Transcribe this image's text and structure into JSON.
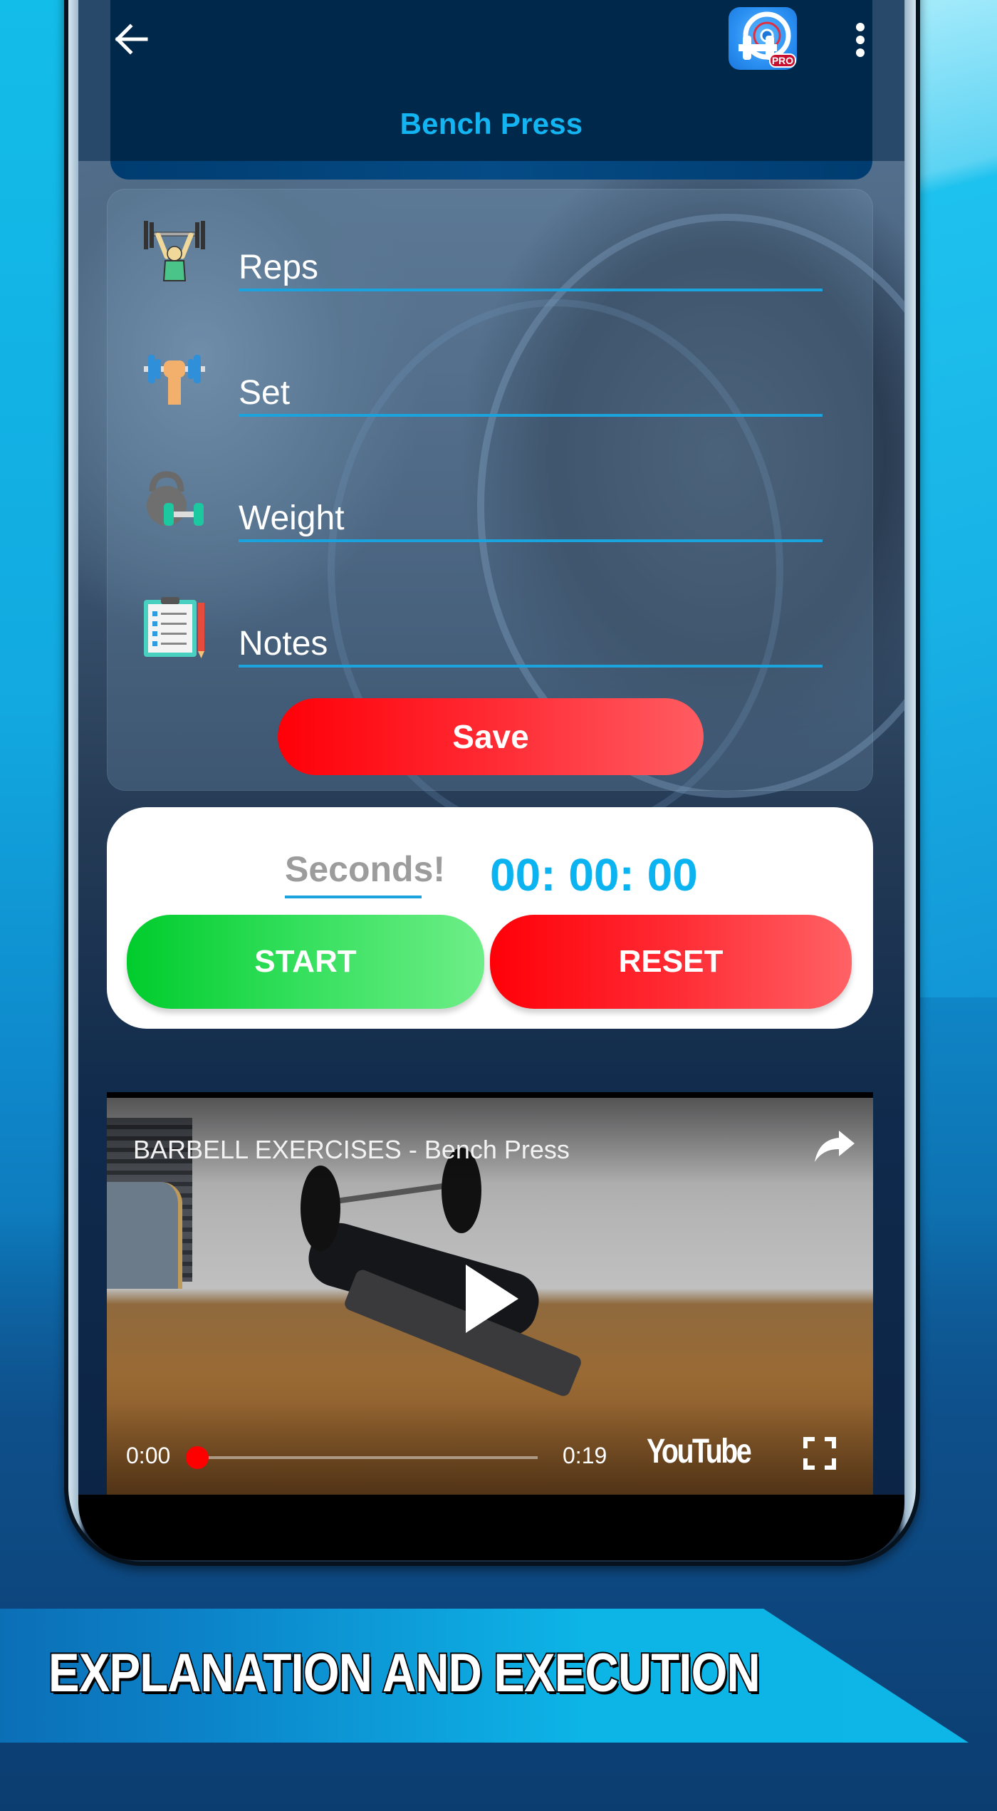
{
  "header": {
    "title": "Bench Press",
    "back_icon": "arrow-left-icon",
    "app_icon": "app-logo-pro-icon",
    "app_icon_badge": "PRO",
    "menu_icon": "more-vertical-icon"
  },
  "form": {
    "fields": [
      {
        "label": "Reps",
        "icon": "weightlifter-icon"
      },
      {
        "label": "Set",
        "icon": "dumbbell-hand-icon"
      },
      {
        "label": "Weight",
        "icon": "kettlebell-dumbbell-icon"
      },
      {
        "label": "Notes",
        "icon": "clipboard-pencil-icon"
      }
    ],
    "save_label": "Save"
  },
  "timer": {
    "seconds_placeholder": "Seconds!",
    "display": "00: 00: 00",
    "start_label": "START",
    "reset_label": "RESET"
  },
  "video": {
    "title": "BARBELL EXERCISES - Bench Press",
    "current_time": "0:00",
    "total_time": "0:19",
    "progress": 0,
    "brand": "YouTube",
    "share_icon": "share-arrow-icon",
    "play_icon": "play-icon",
    "fullscreen_icon": "fullscreen-icon"
  },
  "banner": {
    "text": "EXPLANATION AND EXECUTION"
  },
  "colors": {
    "accent_blue": "#13b4f2",
    "header_bg": "#00284a",
    "save_red": "#ff0008",
    "start_green": "#00cc2c",
    "input_underline": "#1aa3dd",
    "progress_red": "#ff0000"
  }
}
